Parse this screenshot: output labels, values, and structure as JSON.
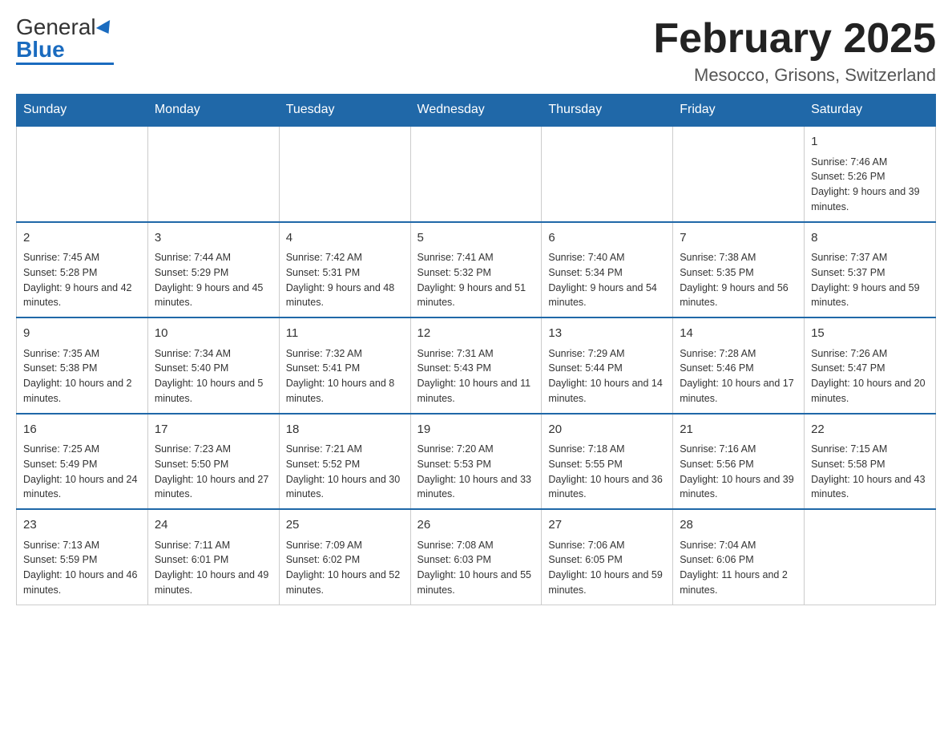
{
  "header": {
    "logo_general": "General",
    "logo_blue": "Blue",
    "title": "February 2025",
    "location": "Mesocco, Grisons, Switzerland"
  },
  "weekdays": [
    "Sunday",
    "Monday",
    "Tuesday",
    "Wednesday",
    "Thursday",
    "Friday",
    "Saturday"
  ],
  "weeks": [
    {
      "days": [
        {
          "date": "",
          "info": ""
        },
        {
          "date": "",
          "info": ""
        },
        {
          "date": "",
          "info": ""
        },
        {
          "date": "",
          "info": ""
        },
        {
          "date": "",
          "info": ""
        },
        {
          "date": "",
          "info": ""
        },
        {
          "date": "1",
          "info": "Sunrise: 7:46 AM\nSunset: 5:26 PM\nDaylight: 9 hours and 39 minutes."
        }
      ]
    },
    {
      "days": [
        {
          "date": "2",
          "info": "Sunrise: 7:45 AM\nSunset: 5:28 PM\nDaylight: 9 hours and 42 minutes."
        },
        {
          "date": "3",
          "info": "Sunrise: 7:44 AM\nSunset: 5:29 PM\nDaylight: 9 hours and 45 minutes."
        },
        {
          "date": "4",
          "info": "Sunrise: 7:42 AM\nSunset: 5:31 PM\nDaylight: 9 hours and 48 minutes."
        },
        {
          "date": "5",
          "info": "Sunrise: 7:41 AM\nSunset: 5:32 PM\nDaylight: 9 hours and 51 minutes."
        },
        {
          "date": "6",
          "info": "Sunrise: 7:40 AM\nSunset: 5:34 PM\nDaylight: 9 hours and 54 minutes."
        },
        {
          "date": "7",
          "info": "Sunrise: 7:38 AM\nSunset: 5:35 PM\nDaylight: 9 hours and 56 minutes."
        },
        {
          "date": "8",
          "info": "Sunrise: 7:37 AM\nSunset: 5:37 PM\nDaylight: 9 hours and 59 minutes."
        }
      ]
    },
    {
      "days": [
        {
          "date": "9",
          "info": "Sunrise: 7:35 AM\nSunset: 5:38 PM\nDaylight: 10 hours and 2 minutes."
        },
        {
          "date": "10",
          "info": "Sunrise: 7:34 AM\nSunset: 5:40 PM\nDaylight: 10 hours and 5 minutes."
        },
        {
          "date": "11",
          "info": "Sunrise: 7:32 AM\nSunset: 5:41 PM\nDaylight: 10 hours and 8 minutes."
        },
        {
          "date": "12",
          "info": "Sunrise: 7:31 AM\nSunset: 5:43 PM\nDaylight: 10 hours and 11 minutes."
        },
        {
          "date": "13",
          "info": "Sunrise: 7:29 AM\nSunset: 5:44 PM\nDaylight: 10 hours and 14 minutes."
        },
        {
          "date": "14",
          "info": "Sunrise: 7:28 AM\nSunset: 5:46 PM\nDaylight: 10 hours and 17 minutes."
        },
        {
          "date": "15",
          "info": "Sunrise: 7:26 AM\nSunset: 5:47 PM\nDaylight: 10 hours and 20 minutes."
        }
      ]
    },
    {
      "days": [
        {
          "date": "16",
          "info": "Sunrise: 7:25 AM\nSunset: 5:49 PM\nDaylight: 10 hours and 24 minutes."
        },
        {
          "date": "17",
          "info": "Sunrise: 7:23 AM\nSunset: 5:50 PM\nDaylight: 10 hours and 27 minutes."
        },
        {
          "date": "18",
          "info": "Sunrise: 7:21 AM\nSunset: 5:52 PM\nDaylight: 10 hours and 30 minutes."
        },
        {
          "date": "19",
          "info": "Sunrise: 7:20 AM\nSunset: 5:53 PM\nDaylight: 10 hours and 33 minutes."
        },
        {
          "date": "20",
          "info": "Sunrise: 7:18 AM\nSunset: 5:55 PM\nDaylight: 10 hours and 36 minutes."
        },
        {
          "date": "21",
          "info": "Sunrise: 7:16 AM\nSunset: 5:56 PM\nDaylight: 10 hours and 39 minutes."
        },
        {
          "date": "22",
          "info": "Sunrise: 7:15 AM\nSunset: 5:58 PM\nDaylight: 10 hours and 43 minutes."
        }
      ]
    },
    {
      "days": [
        {
          "date": "23",
          "info": "Sunrise: 7:13 AM\nSunset: 5:59 PM\nDaylight: 10 hours and 46 minutes."
        },
        {
          "date": "24",
          "info": "Sunrise: 7:11 AM\nSunset: 6:01 PM\nDaylight: 10 hours and 49 minutes."
        },
        {
          "date": "25",
          "info": "Sunrise: 7:09 AM\nSunset: 6:02 PM\nDaylight: 10 hours and 52 minutes."
        },
        {
          "date": "26",
          "info": "Sunrise: 7:08 AM\nSunset: 6:03 PM\nDaylight: 10 hours and 55 minutes."
        },
        {
          "date": "27",
          "info": "Sunrise: 7:06 AM\nSunset: 6:05 PM\nDaylight: 10 hours and 59 minutes."
        },
        {
          "date": "28",
          "info": "Sunrise: 7:04 AM\nSunset: 6:06 PM\nDaylight: 11 hours and 2 minutes."
        },
        {
          "date": "",
          "info": ""
        }
      ]
    }
  ]
}
